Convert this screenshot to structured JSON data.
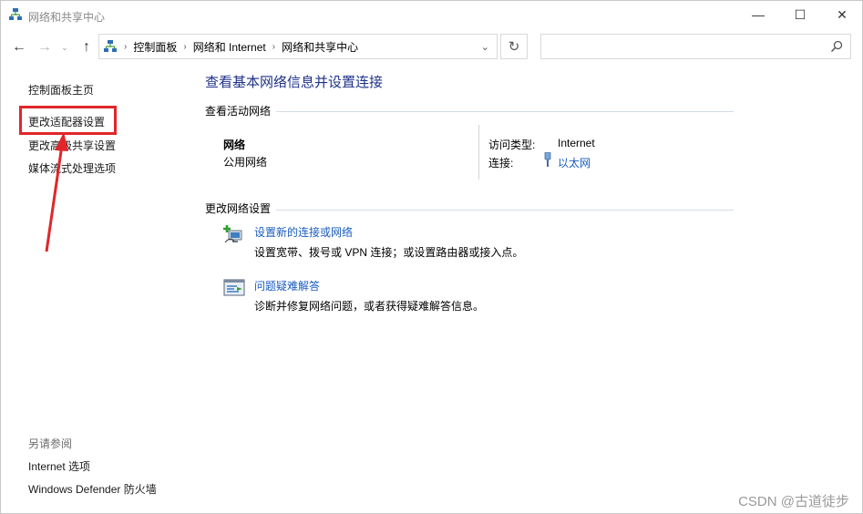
{
  "window": {
    "title": "网络和共享中心",
    "controls": {
      "minimize": "—",
      "maximize": "☐",
      "close": "✕"
    }
  },
  "nav": {
    "back": "←",
    "forward": "→",
    "recent": "⌄",
    "up": "↑",
    "breadcrumbs": [
      "控制面板",
      "网络和 Internet",
      "网络和共享中心"
    ],
    "separator": "›",
    "dropdown": "⌄",
    "refresh": "↻",
    "search_placeholder": ""
  },
  "left_pane": {
    "home": "控制面板主页",
    "links": [
      "更改适配器设置",
      "更改高级共享设置",
      "媒体流式处理选项"
    ],
    "see_also_label": "另请参阅",
    "see_also": [
      "Internet 选项",
      "Windows Defender 防火墙"
    ]
  },
  "main": {
    "title": "查看基本网络信息并设置连接",
    "active_networks_label": "查看活动网络",
    "network": {
      "name": "网络",
      "type": "公用网络",
      "access_type_label": "访问类型:",
      "access_type_value": "Internet",
      "connection_label": "连接:",
      "connection_value": "以太网"
    },
    "change_settings_label": "更改网络设置",
    "tasks": [
      {
        "link": "设置新的连接或网络",
        "desc": "设置宽带、拨号或 VPN 连接；或设置路由器或接入点。",
        "icon": "new-connection-icon"
      },
      {
        "link": "问题疑难解答",
        "desc": "诊断并修复网络问题，或者获得疑难解答信息。",
        "icon": "troubleshoot-icon"
      }
    ]
  },
  "annotation": {
    "highlight_color": "#e0262a"
  },
  "watermark": "CSDN @古道徒步",
  "colors": {
    "link": "#1a5cbf",
    "title": "#1e3287"
  }
}
